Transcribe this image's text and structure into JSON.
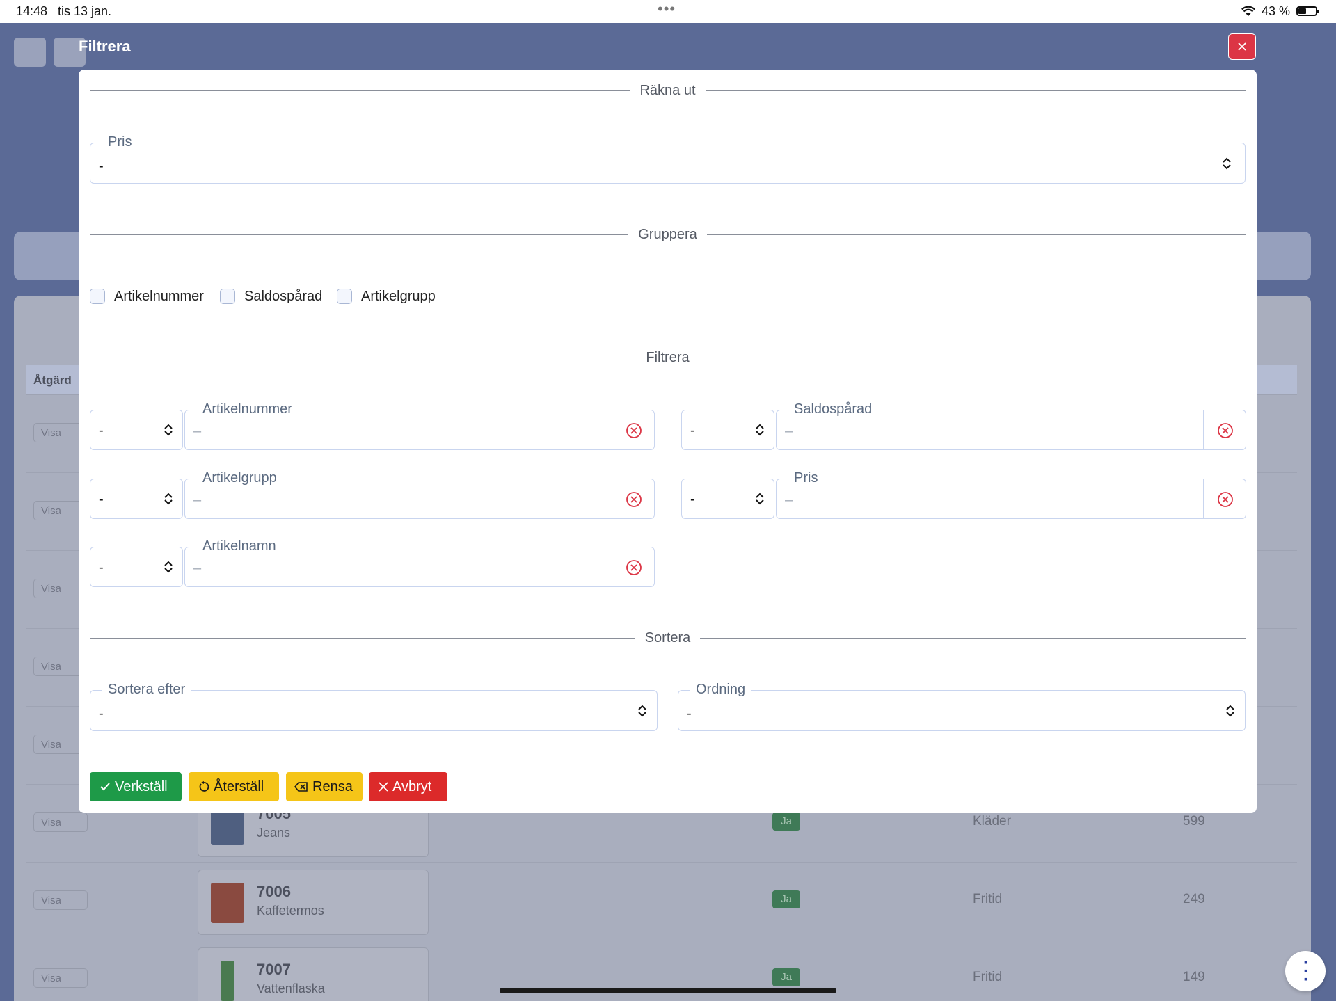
{
  "status_bar": {
    "time": "14:48",
    "date": "tis 13 jan.",
    "battery": "43 %"
  },
  "background": {
    "table_header": "Åtgärd",
    "view_label": "Visa",
    "rows": [
      {
        "number": "7005",
        "name": "Jeans",
        "tracked": "Ja",
        "group": "Kläder",
        "price": "599"
      },
      {
        "number": "7006",
        "name": "Kaffetermos",
        "tracked": "Ja",
        "group": "Fritid",
        "price": "249"
      },
      {
        "number": "7007",
        "name": "Vattenflaska",
        "tracked": "Ja",
        "group": "Fritid",
        "price": "149"
      }
    ]
  },
  "modal": {
    "title": "Filtrera",
    "sections": {
      "calculate": "Räkna ut",
      "group": "Gruppera",
      "filter": "Filtrera",
      "sort": "Sortera"
    },
    "calculate_field": {
      "label": "Pris",
      "value": "-"
    },
    "group_options": [
      "Artikelnummer",
      "Saldospårad",
      "Artikelgrupp"
    ],
    "filters": [
      {
        "operator": "-",
        "label": "Artikelnummer",
        "placeholder": "–"
      },
      {
        "operator": "-",
        "label": "Saldospårad",
        "placeholder": "–"
      },
      {
        "operator": "-",
        "label": "Artikelgrupp",
        "placeholder": "–"
      },
      {
        "operator": "-",
        "label": "Pris",
        "placeholder": "–"
      },
      {
        "operator": "-",
        "label": "Artikelnamn",
        "placeholder": "–"
      }
    ],
    "sort_by": {
      "label": "Sortera efter",
      "value": "-"
    },
    "order": {
      "label": "Ordning",
      "value": "-"
    },
    "buttons": {
      "apply": "Verkställ",
      "reset": "Återställ",
      "clear": "Rensa",
      "cancel": "Avbryt"
    }
  },
  "colors": {
    "primary_green": "#1e9a48",
    "warning_yellow": "#f5c518",
    "danger_red": "#dc2a2a",
    "field_border": "#c9d5ef"
  }
}
